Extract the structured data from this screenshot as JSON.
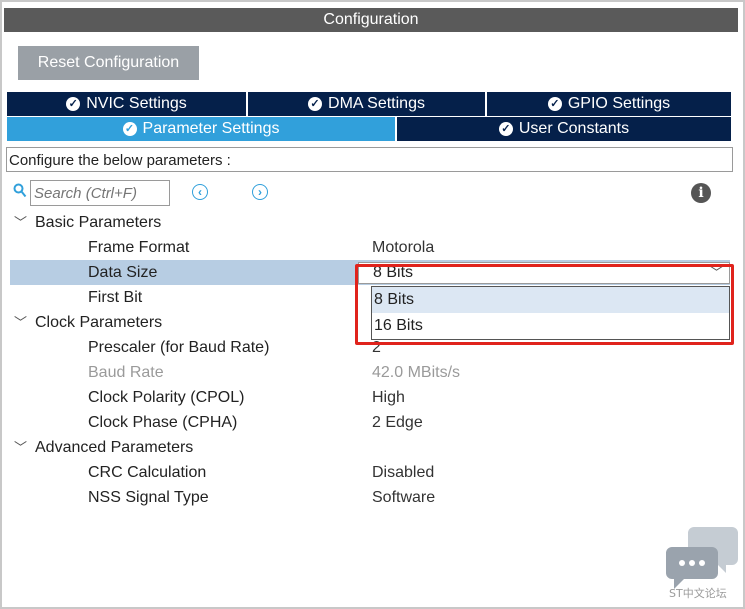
{
  "title": "Configuration",
  "reset_button": "Reset Configuration",
  "tabs_row1": [
    {
      "label": "NVIC Settings"
    },
    {
      "label": "DMA Settings"
    },
    {
      "label": "GPIO Settings"
    }
  ],
  "tabs_row2": [
    {
      "label": "Parameter Settings",
      "active": true
    },
    {
      "label": "User Constants",
      "active": false
    }
  ],
  "configure_text": "Configure the below parameters :",
  "search": {
    "placeholder": "Search (Ctrl+F)"
  },
  "groups": {
    "basic": {
      "label": "Basic Parameters",
      "params": [
        {
          "name": "Frame Format",
          "value": "Motorola"
        },
        {
          "name": "Data Size",
          "value": "8 Bits"
        },
        {
          "name": "First Bit",
          "value": ""
        }
      ]
    },
    "clock": {
      "label": "Clock Parameters",
      "params": [
        {
          "name": "Prescaler (for Baud Rate)",
          "value": "2"
        },
        {
          "name": "Baud Rate",
          "value": "42.0 MBits/s"
        },
        {
          "name": "Clock Polarity (CPOL)",
          "value": "High"
        },
        {
          "name": "Clock Phase (CPHA)",
          "value": "2 Edge"
        }
      ]
    },
    "advanced": {
      "label": "Advanced Parameters",
      "params": [
        {
          "name": "CRC Calculation",
          "value": "Disabled"
        },
        {
          "name": "NSS Signal Type",
          "value": "Software"
        }
      ]
    }
  },
  "dropdown": {
    "current": "8 Bits",
    "options": [
      "8 Bits",
      "16 Bits"
    ]
  },
  "watermark": {
    "text": "ST中文论坛"
  },
  "colors": {
    "accent": "#31a0db",
    "tab_dark": "#05204a",
    "highlight": "#e0231c",
    "selected_row": "#b7cde3"
  }
}
